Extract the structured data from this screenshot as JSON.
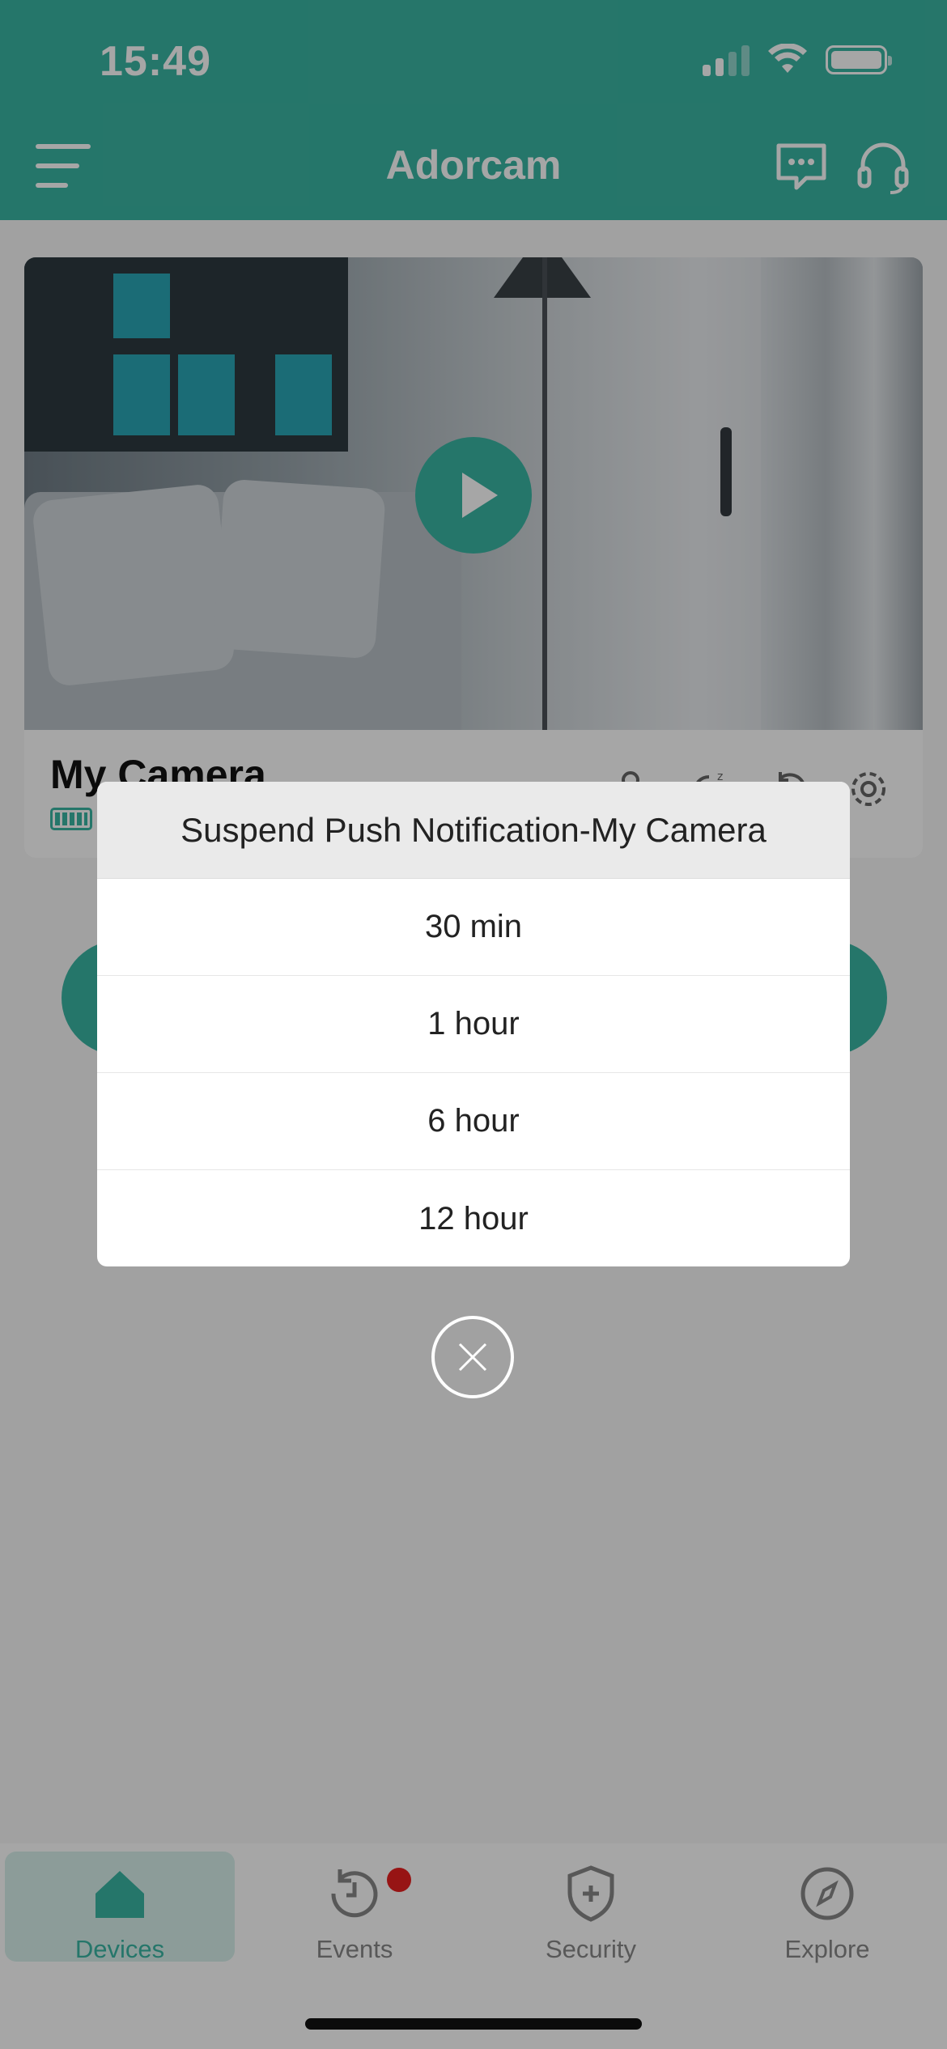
{
  "status_bar": {
    "time": "15:49"
  },
  "header": {
    "title": "Adorcam"
  },
  "camera": {
    "name": "My Camera"
  },
  "tabbar": {
    "tabs": [
      {
        "label": "Devices",
        "icon": "home-icon",
        "active": true
      },
      {
        "label": "Events",
        "icon": "history-icon",
        "badge": true
      },
      {
        "label": "Security",
        "icon": "shield-plus-icon"
      },
      {
        "label": "Explore",
        "icon": "compass-icon"
      }
    ]
  },
  "dialog": {
    "title": "Suspend Push Notification-My Camera",
    "options": [
      "30 min",
      "1 hour",
      "6 hour",
      "12 hour"
    ]
  },
  "colors": {
    "accent": "#3ab5a3",
    "badge": "#e81f1f",
    "overlay": "rgba(0,0,0,0.35)"
  }
}
